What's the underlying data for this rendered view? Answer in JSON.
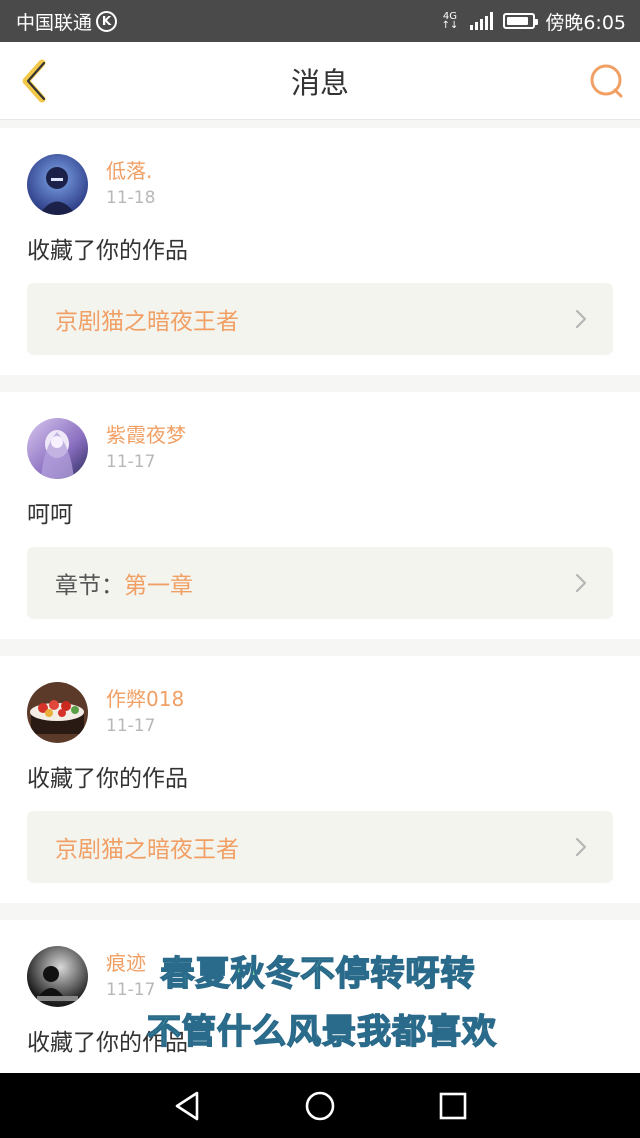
{
  "status_bar": {
    "carrier": "中国联通",
    "carrier_badge": "K",
    "network_top": "4G",
    "network_bottom": "↑↓",
    "battery_level": 0.85,
    "time": "傍晚6:05"
  },
  "header": {
    "title": "消息",
    "accent_color": "#f1a065"
  },
  "messages": [
    {
      "username": "低落.",
      "date": "11-18",
      "action": "收藏了你的作品",
      "ref_title": "京剧猫之暗夜王者"
    },
    {
      "username": "紫霞夜梦",
      "date": "11-17",
      "action": "呵呵",
      "ref_prefix": "章节：",
      "ref_chapter": "第一章"
    },
    {
      "username": "作弊018",
      "date": "11-17",
      "action": "收藏了你的作品",
      "ref_title": "京剧猫之暗夜王者"
    },
    {
      "username": "痕迹",
      "date": "11-17",
      "action": "收藏了你的作品"
    }
  ],
  "subtitles": {
    "line1": "春夏秋冬不停转呀转",
    "line2": "不管什么风景我都喜欢"
  },
  "nav_bar": {
    "back_icon": "triangle-back-icon",
    "home_icon": "circle-home-icon",
    "recents_icon": "square-recents-icon"
  }
}
